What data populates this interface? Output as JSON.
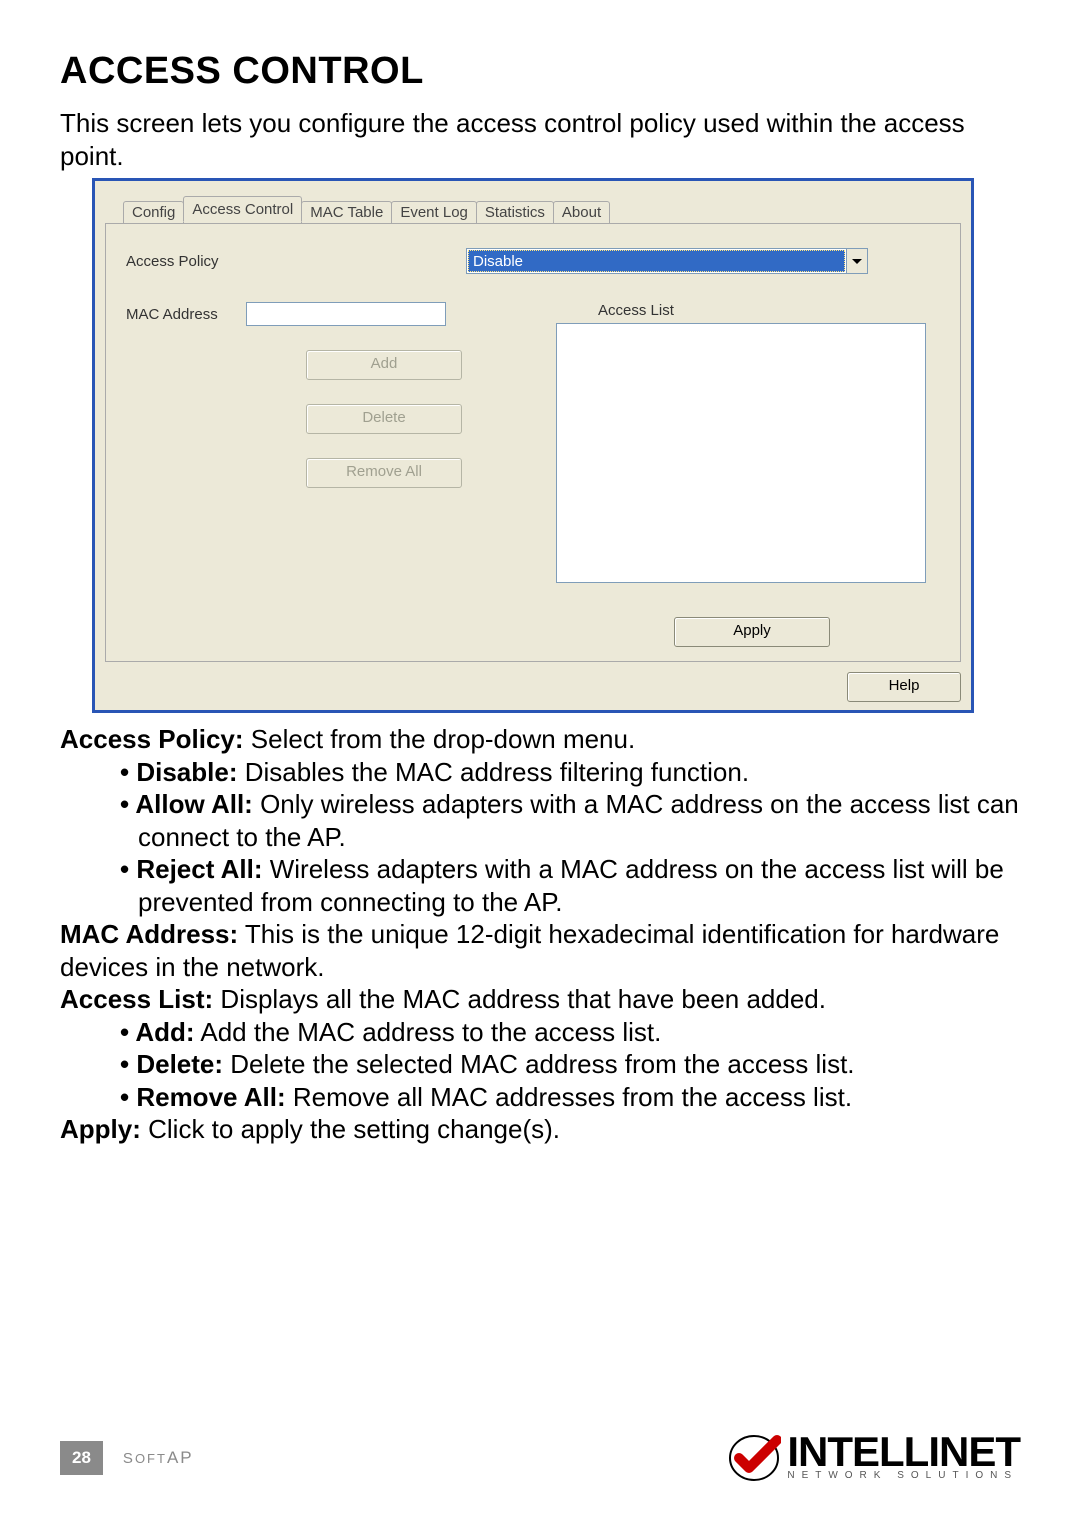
{
  "heading": "Access Control",
  "intro": "This screen lets you configure the access control policy used within the access point.",
  "dialog": {
    "tabs": [
      "Config",
      "Access Control",
      "MAC Table",
      "Event Log",
      "Statistics",
      "About"
    ],
    "active_tab_index": 1,
    "access_policy_label": "Access Policy",
    "access_policy_value": "Disable",
    "mac_address_label": "MAC Address",
    "mac_address_value": "",
    "access_list_label": "Access List",
    "buttons": {
      "add": "Add",
      "delete": "Delete",
      "remove_all": "Remove All",
      "apply": "Apply",
      "help": "Help"
    },
    "access_list_items": []
  },
  "desc": {
    "access_policy_term": "Access Policy:",
    "access_policy_text": " Select from the drop-down menu.",
    "disable_term": "Disable:",
    "disable_text": " Disables the MAC address filtering function.",
    "allow_all_term": "Allow All:",
    "allow_all_text": " Only wireless adapters with a MAC address on the access list can connect to the AP.",
    "reject_all_term": "Reject All:",
    "reject_all_text": " Wireless adapters with a MAC address on the access list will be prevented from connecting to the AP.",
    "mac_address_term": "MAC Address:",
    "mac_address_text": " This is the unique 12-digit hexadecimal identification for hardware devices in the network.",
    "access_list_term": "Access List:",
    "access_list_text": " Displays all the MAC address that have been added.",
    "add_term": "Add:",
    "add_text": " Add the MAC address to the access list.",
    "delete_term": "Delete:",
    "delete_text": " Delete the selected MAC address from the access list.",
    "remove_all_term": "Remove All:",
    "remove_all_text": " Remove all MAC addresses from the access list.",
    "apply_term": "Apply:",
    "apply_text": " Click to apply the setting change(s)."
  },
  "footer": {
    "page_number": "28",
    "section": "SoftAP",
    "brand_name": "INTELLINET",
    "brand_sub": "NETWORK SOLUTIONS"
  },
  "colors": {
    "dialog_border": "#2955b5",
    "dialog_bg": "#ece9d8",
    "dropdown_highlight": "#316ac5"
  }
}
